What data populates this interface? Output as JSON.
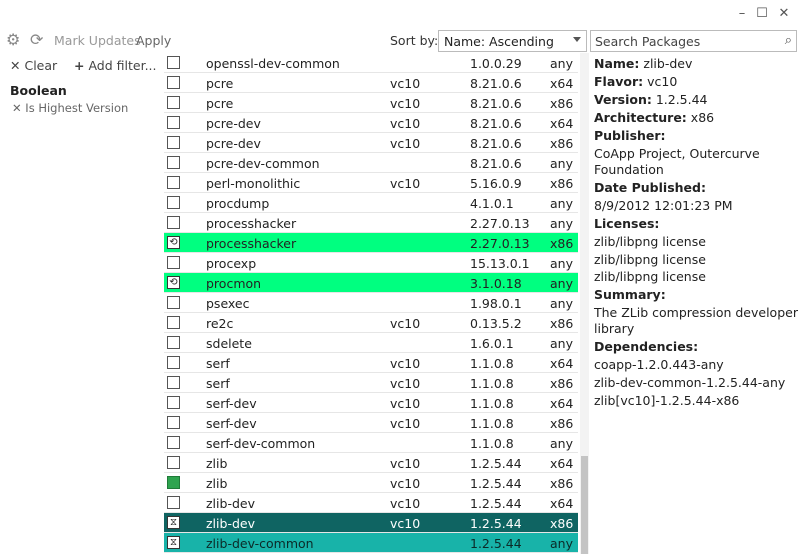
{
  "window": {
    "minimize": "–",
    "maximize": "☐",
    "close": "✕"
  },
  "toolbar": {
    "mark_updates": "Mark Updates",
    "apply": "Apply",
    "sort_label": "Sort by:",
    "sort_value": "Name: Ascending",
    "search_placeholder": "Search Packages"
  },
  "filters": {
    "clear": "Clear",
    "add_filter": "Add filter...",
    "group_title": "Boolean",
    "items": [
      {
        "label": "Is Highest Version"
      }
    ]
  },
  "packages": [
    {
      "name": "openssl-dev-common",
      "flavor": "",
      "version": "1.0.0.29",
      "arch": "any",
      "state": "none"
    },
    {
      "name": "pcre",
      "flavor": "vc10",
      "version": "8.21.0.6",
      "arch": "x64",
      "state": "none"
    },
    {
      "name": "pcre",
      "flavor": "vc10",
      "version": "8.21.0.6",
      "arch": "x86",
      "state": "none"
    },
    {
      "name": "pcre-dev",
      "flavor": "vc10",
      "version": "8.21.0.6",
      "arch": "x64",
      "state": "none"
    },
    {
      "name": "pcre-dev",
      "flavor": "vc10",
      "version": "8.21.0.6",
      "arch": "x86",
      "state": "none"
    },
    {
      "name": "pcre-dev-common",
      "flavor": "",
      "version": "8.21.0.6",
      "arch": "any",
      "state": "none"
    },
    {
      "name": "perl-monolithic",
      "flavor": "vc10",
      "version": "5.16.0.9",
      "arch": "x86",
      "state": "none"
    },
    {
      "name": "procdump",
      "flavor": "",
      "version": "4.1.0.1",
      "arch": "any",
      "state": "none"
    },
    {
      "name": "processhacker",
      "flavor": "",
      "version": "2.27.0.13",
      "arch": "any",
      "state": "none"
    },
    {
      "name": "processhacker",
      "flavor": "",
      "version": "2.27.0.13",
      "arch": "x86",
      "state": "update"
    },
    {
      "name": "procexp",
      "flavor": "",
      "version": "15.13.0.1",
      "arch": "any",
      "state": "none"
    },
    {
      "name": "procmon",
      "flavor": "",
      "version": "3.1.0.18",
      "arch": "any",
      "state": "update"
    },
    {
      "name": "psexec",
      "flavor": "",
      "version": "1.98.0.1",
      "arch": "any",
      "state": "none"
    },
    {
      "name": "re2c",
      "flavor": "vc10",
      "version": "0.13.5.2",
      "arch": "x86",
      "state": "none"
    },
    {
      "name": "sdelete",
      "flavor": "",
      "version": "1.6.0.1",
      "arch": "any",
      "state": "none"
    },
    {
      "name": "serf",
      "flavor": "vc10",
      "version": "1.1.0.8",
      "arch": "x64",
      "state": "none"
    },
    {
      "name": "serf",
      "flavor": "vc10",
      "version": "1.1.0.8",
      "arch": "x86",
      "state": "none"
    },
    {
      "name": "serf-dev",
      "flavor": "vc10",
      "version": "1.1.0.8",
      "arch": "x64",
      "state": "none"
    },
    {
      "name": "serf-dev",
      "flavor": "vc10",
      "version": "1.1.0.8",
      "arch": "x86",
      "state": "none"
    },
    {
      "name": "serf-dev-common",
      "flavor": "",
      "version": "1.1.0.8",
      "arch": "any",
      "state": "none"
    },
    {
      "name": "zlib",
      "flavor": "vc10",
      "version": "1.2.5.44",
      "arch": "x64",
      "state": "none"
    },
    {
      "name": "zlib",
      "flavor": "vc10",
      "version": "1.2.5.44",
      "arch": "x86",
      "state": "installed"
    },
    {
      "name": "zlib-dev",
      "flavor": "vc10",
      "version": "1.2.5.44",
      "arch": "x64",
      "state": "none"
    },
    {
      "name": "zlib-dev",
      "flavor": "vc10",
      "version": "1.2.5.44",
      "arch": "x86",
      "state": "selected"
    },
    {
      "name": "zlib-dev-common",
      "flavor": "",
      "version": "1.2.5.44",
      "arch": "any",
      "state": "selected-alt"
    }
  ],
  "details": {
    "name_label": "Name:",
    "name_value": "zlib-dev",
    "flavor_label": "Flavor:",
    "flavor_value": "vc10",
    "version_label": "Version:",
    "version_value": "1.2.5.44",
    "arch_label": "Architecture:",
    "arch_value": "x86",
    "publisher_label": "Publisher:",
    "publisher_lines": [
      "CoApp Project, Outercurve",
      "Foundation"
    ],
    "date_label": "Date Published:",
    "date_value": "8/9/2012 12:01:23 PM",
    "licenses_label": "Licenses:",
    "licenses": [
      "zlib/libpng license",
      "zlib/libpng license",
      "zlib/libpng license"
    ],
    "summary_label": "Summary:",
    "summary_lines": [
      "The ZLib compression developer",
      "library"
    ],
    "dependencies_label": "Dependencies:",
    "dependencies": [
      "coapp-1.2.0.443-any",
      "zlib-dev-common-1.2.5.44-any",
      "zlib[vc10]-1.2.5.44-x86"
    ]
  },
  "colors": {
    "update_row": "#00ff80",
    "selected_row": "#0f6462",
    "selected_alt_row": "#18b3a9",
    "installed_checkbox": "#2ea44f"
  },
  "icons": {
    "settings": "gear-icon",
    "refresh": "refresh-icon",
    "search": "search-icon",
    "clear": "x-icon",
    "add": "plus-icon",
    "update_mark": "update-icon",
    "selected_mark": "install-icon"
  }
}
